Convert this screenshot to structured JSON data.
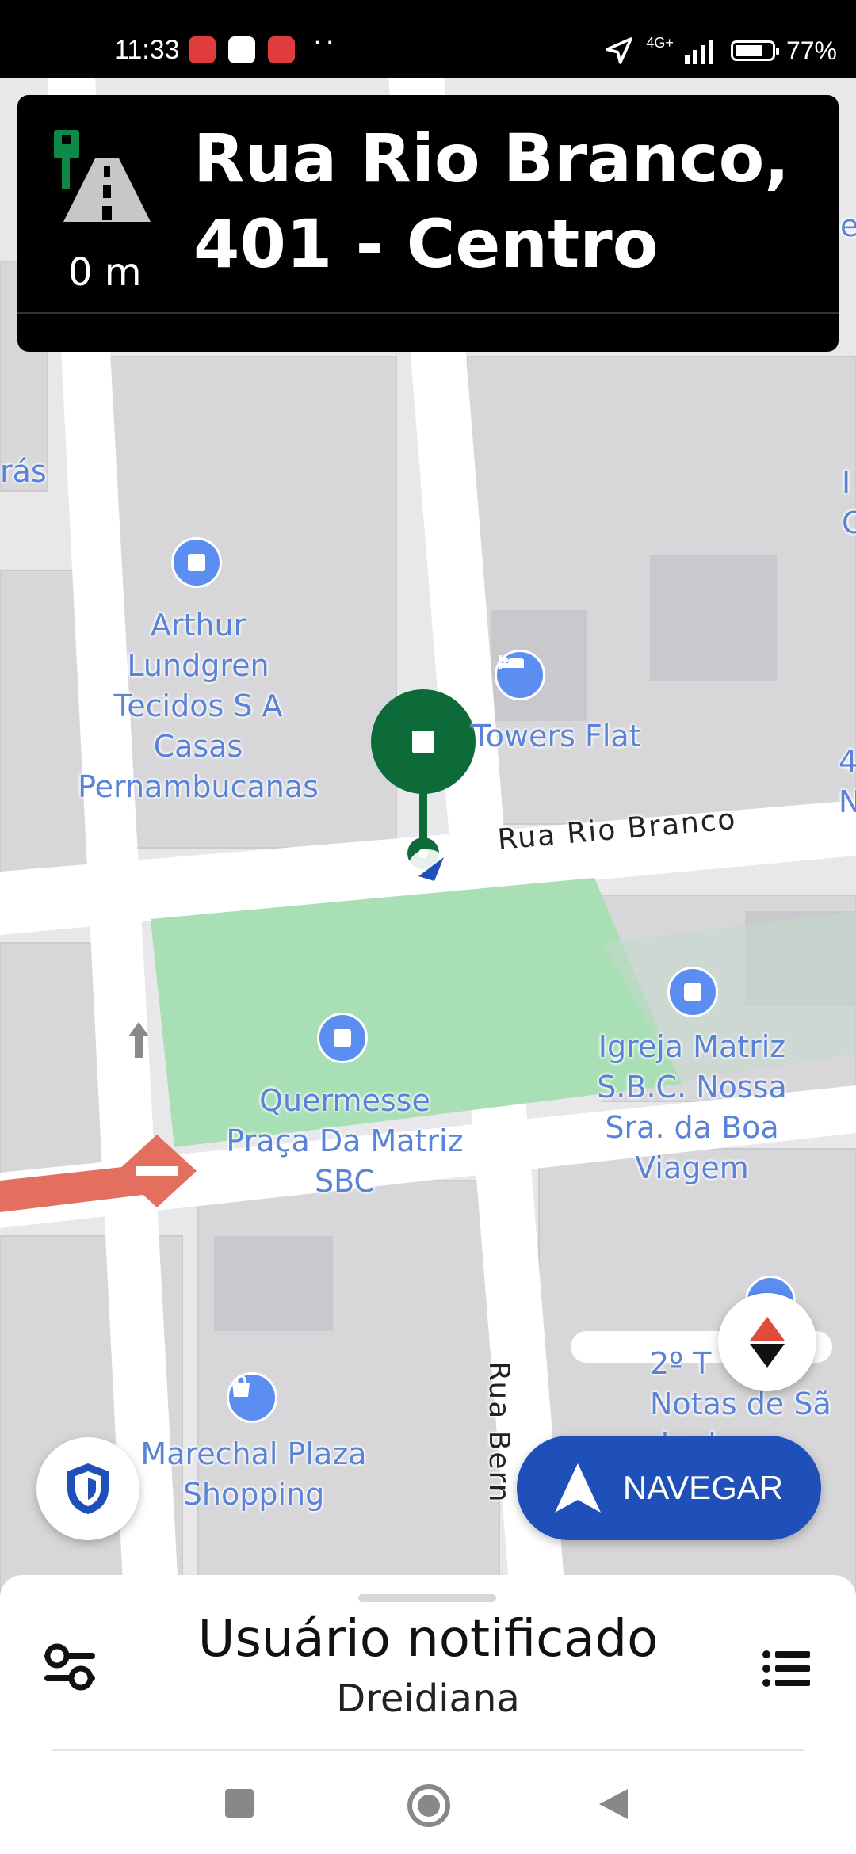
{
  "status_bar": {
    "time": "11:33",
    "signal_label": "4G+",
    "battery": "77%",
    "battery_level": 0.77
  },
  "instruction": {
    "title": "Rua Rio Branco,\n401 - Centro",
    "distance": "0 m"
  },
  "map": {
    "street_labels": {
      "rio_branco": "Rua Rio Branco",
      "bern": "Rua Bern"
    },
    "pois": {
      "arthur": "Arthur\nLundgren\nTecidos S A\nCasas\nPernambucanas",
      "towers": "Towers Flat",
      "quermesse": "Quermesse\nPraça Da Matriz\nSBC",
      "igreja": "Igreja Matriz\nS.B.C. Nossa\nSra. da Boa\nViagem",
      "marechal": "Marechal Plaza\nShopping",
      "tabeliao": "2º T\nNotas de Sã\n do d\n o",
      "left_fragment": "rás",
      "right_fragment_1": "e",
      "right_fragment_2": "I\nC",
      "right_fragment_3": "4\nN"
    },
    "colors": {
      "park": "#a8dfb4",
      "route_closed": "#e36f5f",
      "destination_pin": "#0d6b39",
      "poi_blue": "#5b8ef0"
    }
  },
  "buttons": {
    "navigate": "NAVEGAR"
  },
  "bottom_sheet": {
    "title": "Usuário notificado",
    "subtitle": "Dreidiana"
  }
}
